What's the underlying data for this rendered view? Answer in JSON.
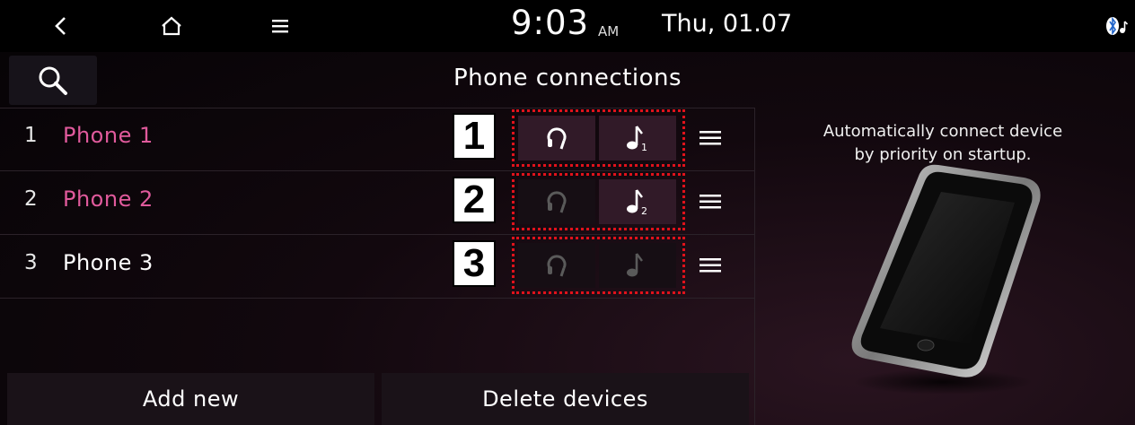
{
  "status_bar": {
    "time": "9:03",
    "ampm": "AM",
    "date": "Thu, 01.07",
    "icons": [
      "back-icon",
      "home-icon",
      "menu-icon",
      "bluetooth-audio-icon"
    ]
  },
  "header": {
    "title": "Phone connections",
    "search_icon": "search-icon"
  },
  "devices": [
    {
      "number": "1",
      "name": "Phone 1",
      "name_color": "#e05a9c",
      "callout": "1",
      "phone_state": "active",
      "audio_state": "active",
      "audio_icon": "music-note-1"
    },
    {
      "number": "2",
      "name": "Phone 2",
      "name_color": "#e05a9c",
      "callout": "2",
      "phone_state": "inactive",
      "audio_state": "active",
      "audio_icon": "music-note-2"
    },
    {
      "number": "3",
      "name": "Phone 3",
      "name_color": "#ffffff",
      "callout": "3",
      "phone_state": "inactive",
      "audio_state": "inactive",
      "audio_icon": "music-note"
    }
  ],
  "footer": {
    "add_new": "Add new",
    "delete_devices": "Delete devices"
  },
  "info_panel": {
    "line1": "Automatically connect device",
    "line2": "by priority on startup."
  },
  "colors": {
    "accent_pink": "#e05a9c",
    "callout_border": "#e0121b",
    "active_button_bg": "#311a28"
  }
}
